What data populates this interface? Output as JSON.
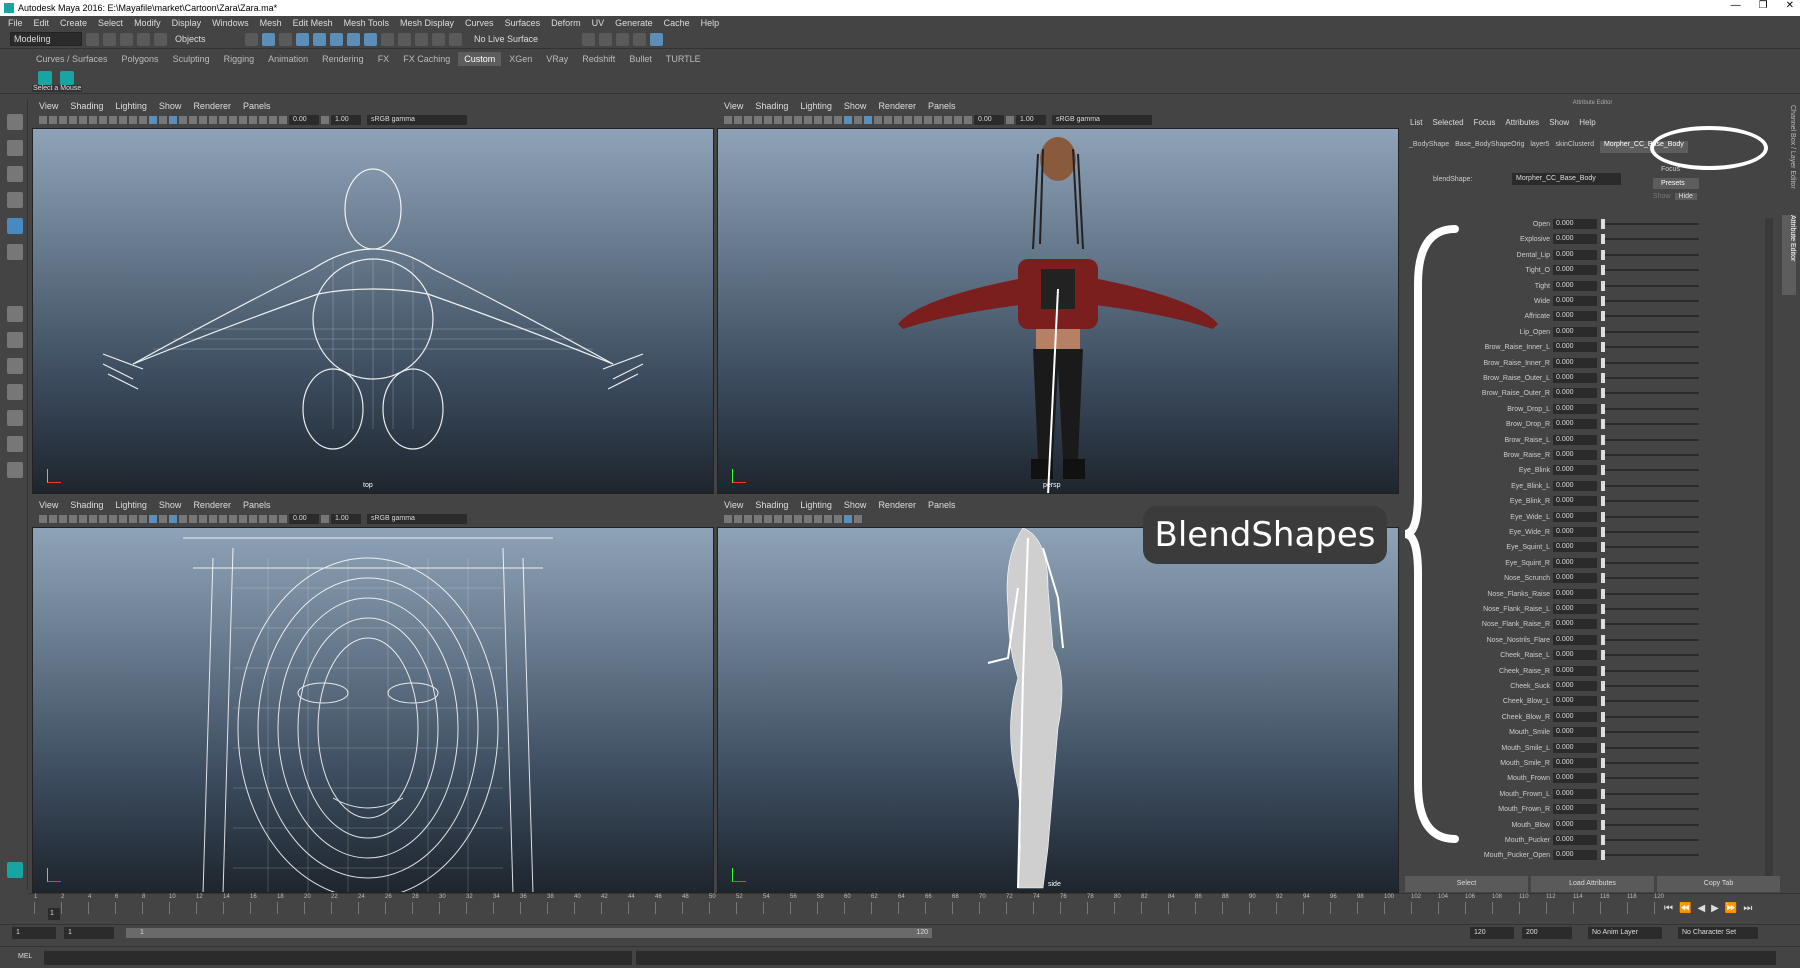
{
  "window": {
    "title": "Autodesk Maya 2016: E:\\Mayafile\\market\\Cartoon\\Zara\\Zara.ma*",
    "controls": [
      "—",
      "❐",
      "✕"
    ]
  },
  "menubar": [
    "File",
    "Edit",
    "Create",
    "Select",
    "Modify",
    "Display",
    "Windows",
    "Mesh",
    "Edit Mesh",
    "Mesh Tools",
    "Mesh Display",
    "Curves",
    "Surfaces",
    "Deform",
    "UV",
    "Generate",
    "Cache",
    "Help"
  ],
  "statusline": {
    "mode": "Modeling",
    "selection": "Objects",
    "live_surface": "No Live Surface"
  },
  "shelf_tabs": [
    "Curves / Surfaces",
    "Polygons",
    "Sculpting",
    "Rigging",
    "Animation",
    "Rendering",
    "FX",
    "FX Caching",
    "Custom",
    "XGen",
    "VRay",
    "Redshift",
    "Bullet",
    "TURTLE"
  ],
  "shelf_active": "Custom",
  "shelf_tooltip": "Select a Mouse",
  "viewport_menu": [
    "View",
    "Shading",
    "Lighting",
    "Show",
    "Renderer",
    "Panels"
  ],
  "viewport_values": {
    "exposure": "0.00",
    "gamma": "1.00",
    "colorspace": "sRGB gamma"
  },
  "viewports": {
    "top": "top",
    "persp": "persp",
    "front": "",
    "side": "side"
  },
  "attribute_editor": {
    "title": "Attribute Editor",
    "menu": [
      "List",
      "Selected",
      "Focus",
      "Attributes",
      "Show",
      "Help"
    ],
    "tabs": [
      "_BodyShape",
      "Base_BodyShapeOrig",
      "layer5",
      "skinClusterd",
      "Morpher_CC_Base_Body"
    ],
    "blendshape_label": "blendShape:",
    "blendshape_value": "Morpher_CC_Base_Body",
    "focus": "Focus",
    "presets": "Presets",
    "show": "Show",
    "hide": "Hide",
    "buttons": [
      "Select",
      "Load Attributes",
      "Copy Tab"
    ]
  },
  "blendshapes": [
    {
      "name": "Open",
      "value": "0.000"
    },
    {
      "name": "Explosive",
      "value": "0.000"
    },
    {
      "name": "Dental_Lip",
      "value": "0.000"
    },
    {
      "name": "Tight_O",
      "value": "0.000"
    },
    {
      "name": "Tight",
      "value": "0.000"
    },
    {
      "name": "Wide",
      "value": "0.000"
    },
    {
      "name": "Affricate",
      "value": "0.000"
    },
    {
      "name": "Lip_Open",
      "value": "0.000"
    },
    {
      "name": "Brow_Raise_Inner_L",
      "value": "0.000"
    },
    {
      "name": "Brow_Raise_Inner_R",
      "value": "0.000"
    },
    {
      "name": "Brow_Raise_Outer_L",
      "value": "0.000"
    },
    {
      "name": "Brow_Raise_Outer_R",
      "value": "0.000"
    },
    {
      "name": "Brow_Drop_L",
      "value": "0.000"
    },
    {
      "name": "Brow_Drop_R",
      "value": "0.000"
    },
    {
      "name": "Brow_Raise_L",
      "value": "0.000"
    },
    {
      "name": "Brow_Raise_R",
      "value": "0.000"
    },
    {
      "name": "Eye_Blink",
      "value": "0.000"
    },
    {
      "name": "Eye_Blink_L",
      "value": "0.000"
    },
    {
      "name": "Eye_Blink_R",
      "value": "0.000"
    },
    {
      "name": "Eye_Wide_L",
      "value": "0.000"
    },
    {
      "name": "Eye_Wide_R",
      "value": "0.000"
    },
    {
      "name": "Eye_Squint_L",
      "value": "0.000"
    },
    {
      "name": "Eye_Squint_R",
      "value": "0.000"
    },
    {
      "name": "Nose_Scrunch",
      "value": "0.000"
    },
    {
      "name": "Nose_Flanks_Raise",
      "value": "0.000"
    },
    {
      "name": "Nose_Flank_Raise_L",
      "value": "0.000"
    },
    {
      "name": "Nose_Flank_Raise_R",
      "value": "0.000"
    },
    {
      "name": "Nose_Nostrils_Flare",
      "value": "0.000"
    },
    {
      "name": "Cheek_Raise_L",
      "value": "0.000"
    },
    {
      "name": "Cheek_Raise_R",
      "value": "0.000"
    },
    {
      "name": "Cheek_Suck",
      "value": "0.000"
    },
    {
      "name": "Cheek_Blow_L",
      "value": "0.000"
    },
    {
      "name": "Cheek_Blow_R",
      "value": "0.000"
    },
    {
      "name": "Mouth_Smile",
      "value": "0.000"
    },
    {
      "name": "Mouth_Smile_L",
      "value": "0.000"
    },
    {
      "name": "Mouth_Smile_R",
      "value": "0.000"
    },
    {
      "name": "Mouth_Frown",
      "value": "0.000"
    },
    {
      "name": "Mouth_Frown_L",
      "value": "0.000"
    },
    {
      "name": "Mouth_Frown_R",
      "value": "0.000"
    },
    {
      "name": "Mouth_Blow",
      "value": "0.000"
    },
    {
      "name": "Mouth_Pucker",
      "value": "0.000"
    },
    {
      "name": "Mouth_Pucker_Open",
      "value": "0.000"
    }
  ],
  "callout": "BlendShapes",
  "side_tabs": {
    "channel": "Channel Box / Layer Editor",
    "attr": "Attribute Editor"
  },
  "timeline": {
    "ticks": [
      "1",
      "2",
      "4",
      "6",
      "8",
      "10",
      "12",
      "14",
      "16",
      "18",
      "20",
      "22",
      "24",
      "26",
      "28",
      "30",
      "32",
      "34",
      "36",
      "38",
      "40",
      "42",
      "44",
      "46",
      "48",
      "50",
      "52",
      "54",
      "56",
      "58",
      "60",
      "62",
      "64",
      "66",
      "68",
      "70",
      "72",
      "74",
      "76",
      "78",
      "80",
      "82",
      "84",
      "86",
      "88",
      "90",
      "92",
      "94",
      "96",
      "98",
      "100",
      "102",
      "104",
      "106",
      "108",
      "110",
      "112",
      "114",
      "116",
      "118",
      "120"
    ],
    "current": "1",
    "current_field": "1"
  },
  "range": {
    "start": "1",
    "start2": "1",
    "slider_start": "1",
    "slider_end": "120",
    "end": "120",
    "end2": "200",
    "anim_layer": "No Anim Layer",
    "char_set": "No Character Set"
  },
  "cmdline": {
    "label": "MEL"
  }
}
